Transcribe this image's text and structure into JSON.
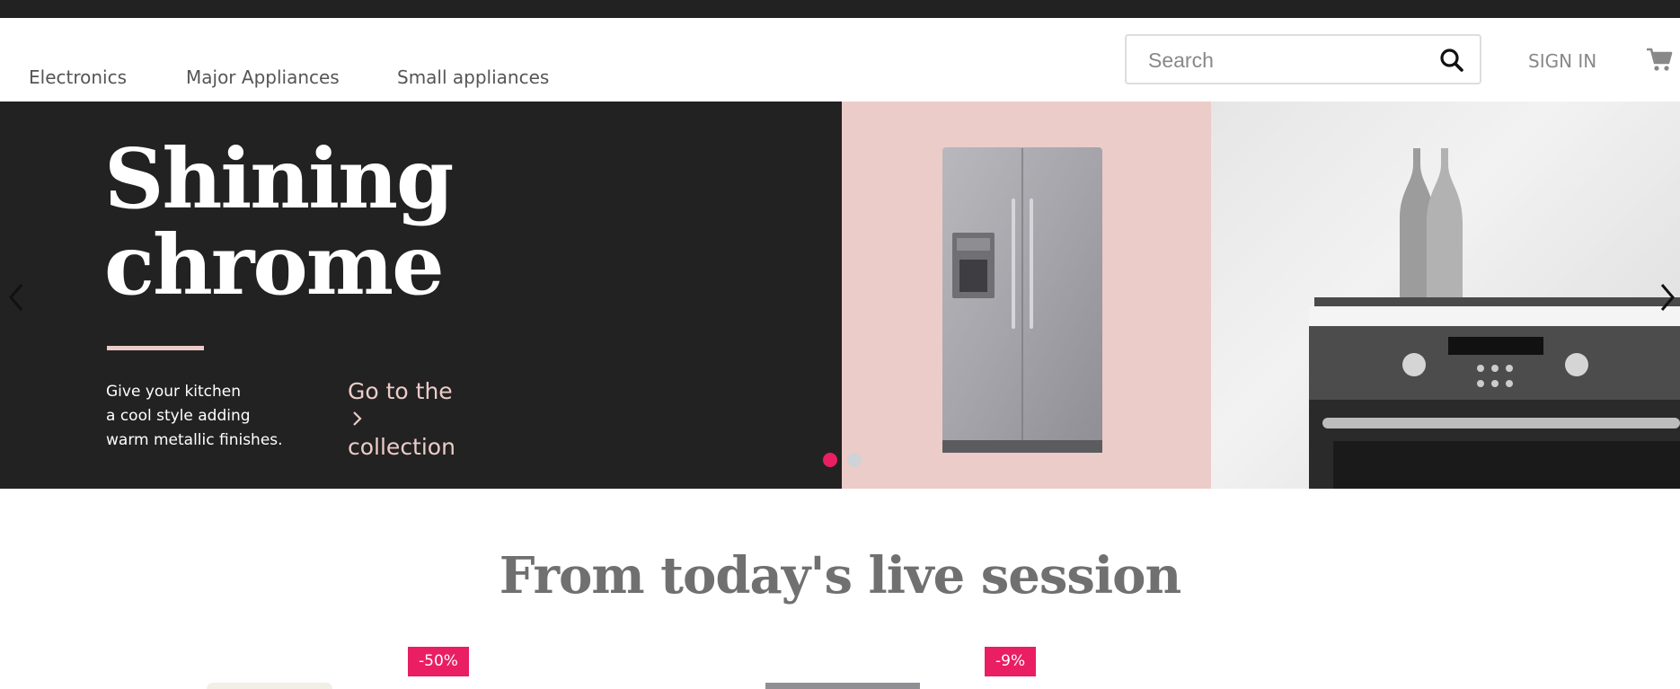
{
  "nav": {
    "links": [
      "Electronics",
      "Major Appliances",
      "Small appliances"
    ],
    "search_placeholder": "Search",
    "sign_in": "SIGN IN"
  },
  "hero": {
    "title_line1": "Shining",
    "title_line2": "chrome",
    "desc_lines": [
      "Give your kitchen",
      "a cool style adding",
      "warm metallic finishes."
    ],
    "cta_line1": "Go to the",
    "cta_line2": "collection",
    "slide_count": 2,
    "active_slide": 1
  },
  "section": {
    "title": "From today's live session"
  },
  "products": [
    {
      "badge": "-50%"
    },
    {
      "badge": "-9%"
    }
  ],
  "colors": {
    "dark": "#222222",
    "pink": "#ecccc8",
    "accent": "#e91e63",
    "inactive_dot": "#cfd3d8"
  }
}
